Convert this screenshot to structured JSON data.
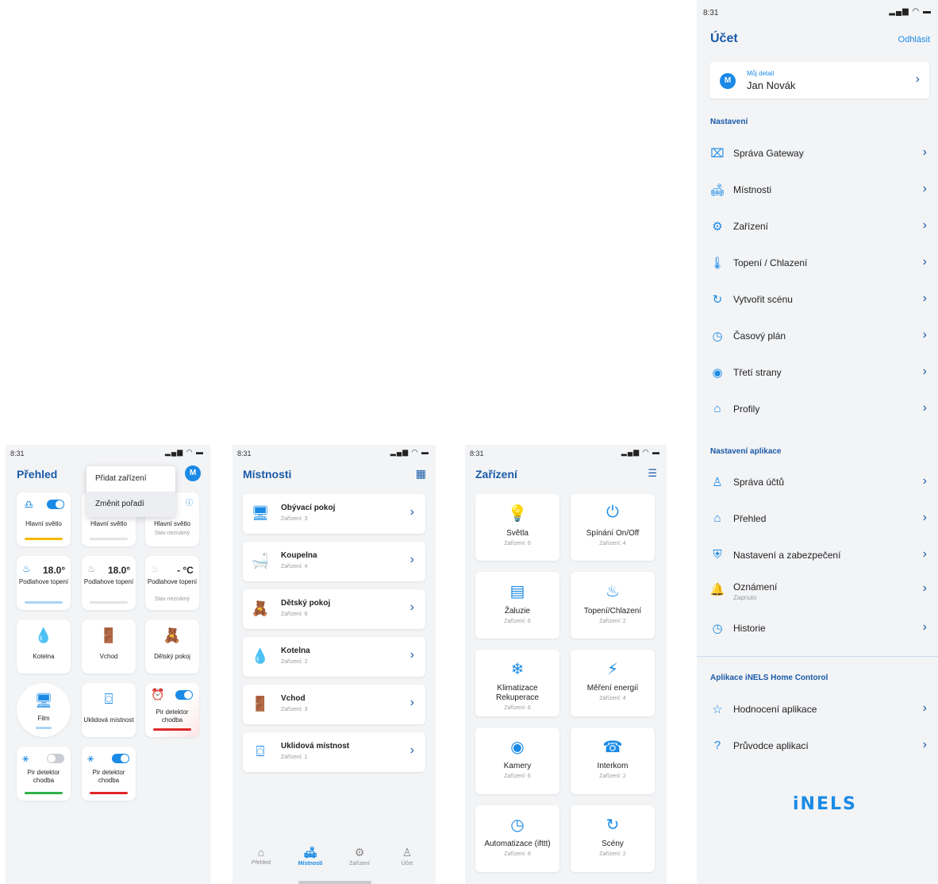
{
  "overview": {
    "time": "8:31",
    "title": "Přehled",
    "avatar": "M",
    "menu": [
      "Přidat zařízení",
      "Změnit pořadí"
    ],
    "tiles": {
      "light1": "Hlavní světlo",
      "light2": "Hlavní světlo",
      "light3": "Hlavní světlo",
      "unknown": "Stav neznámý",
      "heat1_temp": "18.0°",
      "heat1": "Podlahove topení",
      "heat2_temp": "18.0°",
      "heat2": "Podlahove topení",
      "heat3_temp": "- °C",
      "heat3": "Podlahove topení",
      "kotelna": "Kotelna",
      "vchod": "Vchod",
      "detsky": "Dětský pokoj",
      "film": "Film",
      "uklid": "Uklidová místnost",
      "pir1": "Pir detektor chodba",
      "pir2": "Pir detektor chodba",
      "pir3": "Pir detektor chodba"
    },
    "colors": {
      "yellow": "#f5b800",
      "blue_light": "#a9d4f5",
      "grey": "#e1e3e7",
      "red": "#e02828",
      "green": "#2fb34a"
    }
  },
  "rooms": {
    "time": "8:31",
    "title": "Místnosti",
    "items": [
      {
        "name": "Obývací pokoj",
        "sub": "Zařízení: 3"
      },
      {
        "name": "Koupelna",
        "sub": "Zařízení: 4"
      },
      {
        "name": "Dětský pokoj",
        "sub": "Zařízení: 6"
      },
      {
        "name": "Kotelna",
        "sub": "Zařízení: 2"
      },
      {
        "name": "Vchod",
        "sub": "Zařízení: 3"
      },
      {
        "name": "Uklidová místnost",
        "sub": "Zařízení: 1"
      }
    ],
    "nav": [
      "Přehled",
      "Místnosti",
      "Zařízení",
      "Účet"
    ]
  },
  "devices": {
    "time": "8:31",
    "title": "Zařízení",
    "items": [
      {
        "name": "Světla",
        "sub": "Zařízení: 6"
      },
      {
        "name": "Spínání On/Off",
        "sub": "Zařízení: 4"
      },
      {
        "name": "Žaluzie",
        "sub": "Zařízení: 6"
      },
      {
        "name": "Topení/Chlazení",
        "sub": "Zařízení: 2"
      },
      {
        "name": "Klimatizace Rekuperace",
        "sub": "Zařízení: 6"
      },
      {
        "name": "Měření energií",
        "sub": "Zařízení: 4"
      },
      {
        "name": "Kamery",
        "sub": "Zařízení: 6"
      },
      {
        "name": "Interkom",
        "sub": "Zařízení: 2"
      },
      {
        "name": "Automatizace (ifttt)",
        "sub": "Zařízení: 6"
      },
      {
        "name": "Scény",
        "sub": "Zařízení: 2"
      }
    ]
  },
  "account": {
    "time": "8:31",
    "title": "Účet",
    "logout": "Odhlásit",
    "my_detail_small": "Můj detail",
    "my_detail_name": "Jan Novák",
    "avatar": "M",
    "settings_title": "Nastavení",
    "settings": [
      "Správa Gateway",
      "Místnosti",
      "Zařízení",
      "Topení / Chlazení",
      "Vytvořit scénu",
      "Časový plán",
      "Třetí strany",
      "Profily"
    ],
    "app_settings_title": "Nastavení aplikace",
    "app_settings": [
      "Správa účtů",
      "Přehled",
      "Nastavení a zabezpečení",
      "Oznámení",
      "Historie"
    ],
    "notifications_sub": "Zapnuto",
    "app_title": "Aplikace iNELS Home Contorol",
    "app": [
      "Hodnocení aplikace",
      "Průvodce aplikací"
    ],
    "logo": "iNELS"
  }
}
